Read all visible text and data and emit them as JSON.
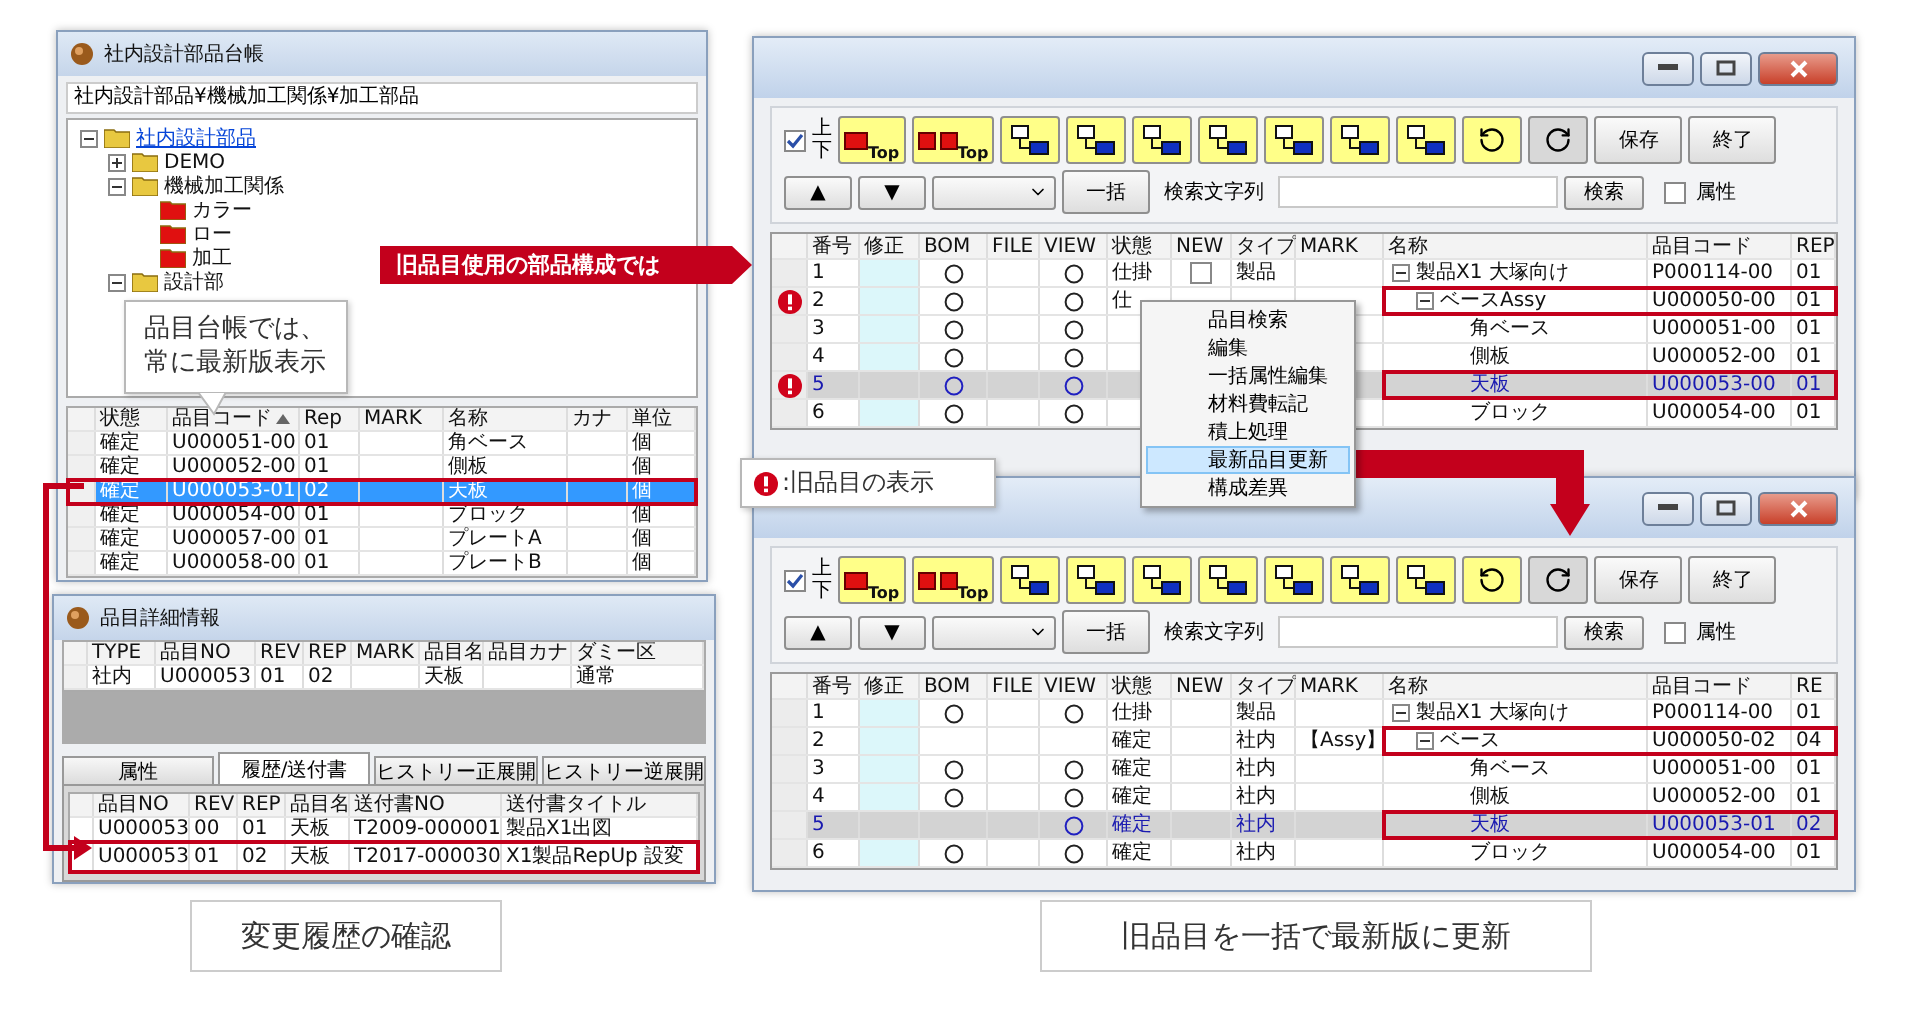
{
  "ledger_window": {
    "title": "社内設計部品台帳",
    "path": "社内設計部品¥機械加工関係¥加工部品",
    "tree": [
      {
        "label": "社内設計部品",
        "link": true,
        "expanded": true,
        "color": "#e8c840",
        "children": [
          {
            "label": "DEMO",
            "expanded": false,
            "color": "#e8c840"
          },
          {
            "label": "機械加工関係",
            "expanded": true,
            "color": "#e8c840",
            "children": [
              {
                "label": "カラー",
                "color": "#e01010"
              },
              {
                "label": "ロー",
                "color": "#e01010"
              },
              {
                "label": "加工",
                "color": "#e01010"
              }
            ]
          },
          {
            "label": "設計部",
            "expanded": true,
            "color": "#e8c840"
          }
        ]
      }
    ],
    "columns": [
      {
        "label": "状態",
        "sorted": false
      },
      {
        "label": "品目コード",
        "sorted": true
      },
      {
        "label": "Rep",
        "sorted": false
      },
      {
        "label": "MARK",
        "sorted": false
      },
      {
        "label": "名称",
        "sorted": false
      },
      {
        "label": "カナ",
        "sorted": false
      },
      {
        "label": "単位",
        "sorted": false
      }
    ],
    "rows": [
      {
        "status": "確定",
        "code": "U000051-00",
        "rep": "01",
        "name": "角ベース",
        "unit": "個",
        "selected": false,
        "framed": false
      },
      {
        "status": "確定",
        "code": "U000052-00",
        "rep": "01",
        "name": "側板",
        "unit": "個",
        "selected": false,
        "framed": false
      },
      {
        "status": "確定",
        "code": "U000053-01",
        "rep": "02",
        "name": "天板",
        "unit": "個",
        "selected": true,
        "framed": true
      },
      {
        "status": "確定",
        "code": "U000054-00",
        "rep": "01",
        "name": "ブロック",
        "unit": "個",
        "selected": false,
        "framed": false
      },
      {
        "status": "確定",
        "code": "U000057-00",
        "rep": "01",
        "name": "プレートA",
        "unit": "個",
        "selected": false,
        "framed": false
      },
      {
        "status": "確定",
        "code": "U000058-00",
        "rep": "01",
        "name": "プレートB",
        "unit": "個",
        "selected": false,
        "framed": false
      }
    ]
  },
  "detail_window": {
    "title": "品目詳細情報",
    "columns": [
      "TYPE",
      "品目NO",
      "REV",
      "REP",
      "MARK",
      "品目名",
      "品目カナ",
      "ダミー区"
    ],
    "row": {
      "type": "社内",
      "no": "U000053",
      "rev": "01",
      "rep": "02",
      "name": "天板",
      "dummy": "通常"
    },
    "tabs": [
      {
        "label": "属性",
        "selected": false
      },
      {
        "label": "履歴/送付書",
        "selected": true
      },
      {
        "label": "ヒストリー正展開",
        "selected": false
      },
      {
        "label": "ヒストリー逆展開",
        "selected": false
      }
    ],
    "history_columns": [
      "品目NO",
      "REV",
      "REP",
      "品目名",
      "送付書NO",
      "送付書タイトル"
    ],
    "history_rows": [
      {
        "no": "U000053",
        "rev": "00",
        "rep": "01",
        "name": "天板",
        "doc_no": "T2009-000001",
        "doc_title": "製品X1出図",
        "framed": false
      },
      {
        "no": "U000053",
        "rev": "01",
        "rep": "02",
        "name": "天板",
        "doc_no": "T2017-000030",
        "doc_title": "X1製品RepUp 設変",
        "framed": true
      }
    ]
  },
  "structure_before": {
    "toolbar": [
      {
        "kind": "top_single",
        "label": "Top"
      },
      {
        "kind": "top_double",
        "label": "Top"
      },
      {
        "kind": "flow"
      },
      {
        "kind": "flow"
      },
      {
        "kind": "flow"
      },
      {
        "kind": "flow"
      },
      {
        "kind": "flow"
      },
      {
        "kind": "flow"
      },
      {
        "kind": "flow"
      },
      {
        "kind": "undo"
      },
      {
        "kind": "redo"
      },
      {
        "kind": "text",
        "label": "保存"
      },
      {
        "kind": "text",
        "label": "終了"
      }
    ],
    "sync": {
      "label": "上下",
      "checked": true
    },
    "up": "▲",
    "down": "▼",
    "bulk_button": "一括",
    "search_label": "検索文字列",
    "search_button": "検索",
    "attr_checkbox": {
      "label": "属性",
      "checked": false
    },
    "columns": [
      "番号",
      "修正",
      "BOM",
      "FILE",
      "VIEW",
      "状態",
      "NEW",
      "タイプ",
      "MARK",
      "名称",
      "品目コード",
      "REP"
    ],
    "rows": [
      {
        "no": "1",
        "bom": true,
        "view": true,
        "status": "仕掛",
        "new_box": {
          "checked": false
        },
        "type": "製品",
        "name": "製品X1 大塚向け",
        "code": "P000114-00",
        "rep": "01",
        "warning": false,
        "selected": false,
        "framed": false,
        "expanded": true,
        "children": [
          {
            "no": "2",
            "bom": true,
            "view": true,
            "status": "仕",
            "name": "ベースAssy",
            "code": "U000050-00",
            "rep": "01",
            "warning": true,
            "selected": false,
            "framed": true,
            "expanded": true,
            "children": [
              {
                "no": "3",
                "bom": true,
                "view": true,
                "name": "角ベース",
                "code": "U000051-00",
                "rep": "01",
                "warning": false,
                "selected": false,
                "framed": false
              },
              {
                "no": "4",
                "bom": true,
                "view": true,
                "name": "側板",
                "code": "U000052-00",
                "rep": "01",
                "warning": false,
                "selected": false,
                "framed": false
              },
              {
                "no": "5",
                "bom": true,
                "view": true,
                "name": "天板",
                "code": "U000053-00",
                "rep": "01",
                "warning": true,
                "selected": true,
                "framed": true
              },
              {
                "no": "6",
                "bom": true,
                "view": true,
                "name": "ブロック",
                "code": "U000054-00",
                "rep": "01",
                "warning": false,
                "selected": false,
                "framed": false
              }
            ]
          }
        ]
      }
    ],
    "context_menu": [
      {
        "label": "品目検索",
        "selected": false
      },
      {
        "label": "編集",
        "selected": false
      },
      {
        "label": "一括属性編集",
        "selected": false
      },
      {
        "label": "材料費転記",
        "selected": false
      },
      {
        "label": "積上処理",
        "selected": false
      },
      {
        "label": "最新品目更新",
        "selected": true
      },
      {
        "label": "構成差異",
        "selected": false
      }
    ]
  },
  "structure_after": {
    "toolbar": [
      {
        "kind": "top_single",
        "label": "Top"
      },
      {
        "kind": "top_double",
        "label": "Top"
      },
      {
        "kind": "flow"
      },
      {
        "kind": "flow"
      },
      {
        "kind": "flow"
      },
      {
        "kind": "flow"
      },
      {
        "kind": "flow"
      },
      {
        "kind": "flow"
      },
      {
        "kind": "flow"
      },
      {
        "kind": "undo"
      },
      {
        "kind": "redo"
      },
      {
        "kind": "text",
        "label": "保存"
      },
      {
        "kind": "text",
        "label": "終了"
      }
    ],
    "sync": {
      "label": "上下",
      "checked": true
    },
    "up": "▲",
    "down": "▼",
    "bulk_button": "一括",
    "search_label": "検索文字列",
    "search_button": "検索",
    "attr_checkbox": {
      "label": "属性",
      "checked": false
    },
    "columns": [
      "番号",
      "修正",
      "BOM",
      "FILE",
      "VIEW",
      "状態",
      "NEW",
      "タイプ",
      "MARK",
      "名称",
      "品目コード",
      "RE"
    ],
    "rows": [
      {
        "no": "1",
        "bom": true,
        "view": true,
        "status": "仕掛",
        "type": "製品",
        "name": "製品X1 大塚向け",
        "code": "P000114-00",
        "rep": "01",
        "warning": false,
        "selected": false,
        "framed": false,
        "expanded": true,
        "children": [
          {
            "no": "2",
            "bom": false,
            "view": false,
            "status": "確定",
            "type": "社内",
            "mark": "【Assy】",
            "name": "ベース",
            "code": "U000050-02",
            "rep": "04",
            "warning": false,
            "selected": false,
            "framed": true,
            "expanded": true,
            "children": [
              {
                "no": "3",
                "bom": true,
                "view": true,
                "status": "確定",
                "type": "社内",
                "name": "角ベース",
                "code": "U000051-00",
                "rep": "01",
                "warning": false,
                "selected": false,
                "framed": false
              },
              {
                "no": "4",
                "bom": true,
                "view": true,
                "status": "確定",
                "type": "社内",
                "name": "側板",
                "code": "U000052-00",
                "rep": "01",
                "warning": false,
                "selected": false,
                "framed": false
              },
              {
                "no": "5",
                "bom": false,
                "view": true,
                "status": "確定",
                "type": "社内",
                "name": "天板",
                "code": "U000053-01",
                "rep": "02",
                "warning": false,
                "selected": true,
                "framed": true
              },
              {
                "no": "6",
                "bom": true,
                "view": true,
                "status": "確定",
                "type": "社内",
                "name": "ブロック",
                "code": "U000054-00",
                "rep": "01",
                "warning": false,
                "selected": false,
                "framed": false
              }
            ]
          }
        ]
      }
    ]
  },
  "ledger_callout": "品目台帳では、常に最新版表示",
  "banner": "旧品目使用の部品構成では",
  "legend": ":旧品目の表示",
  "captions": [
    "変更履歴の確認",
    "旧品目を一括で最新版に更新"
  ]
}
